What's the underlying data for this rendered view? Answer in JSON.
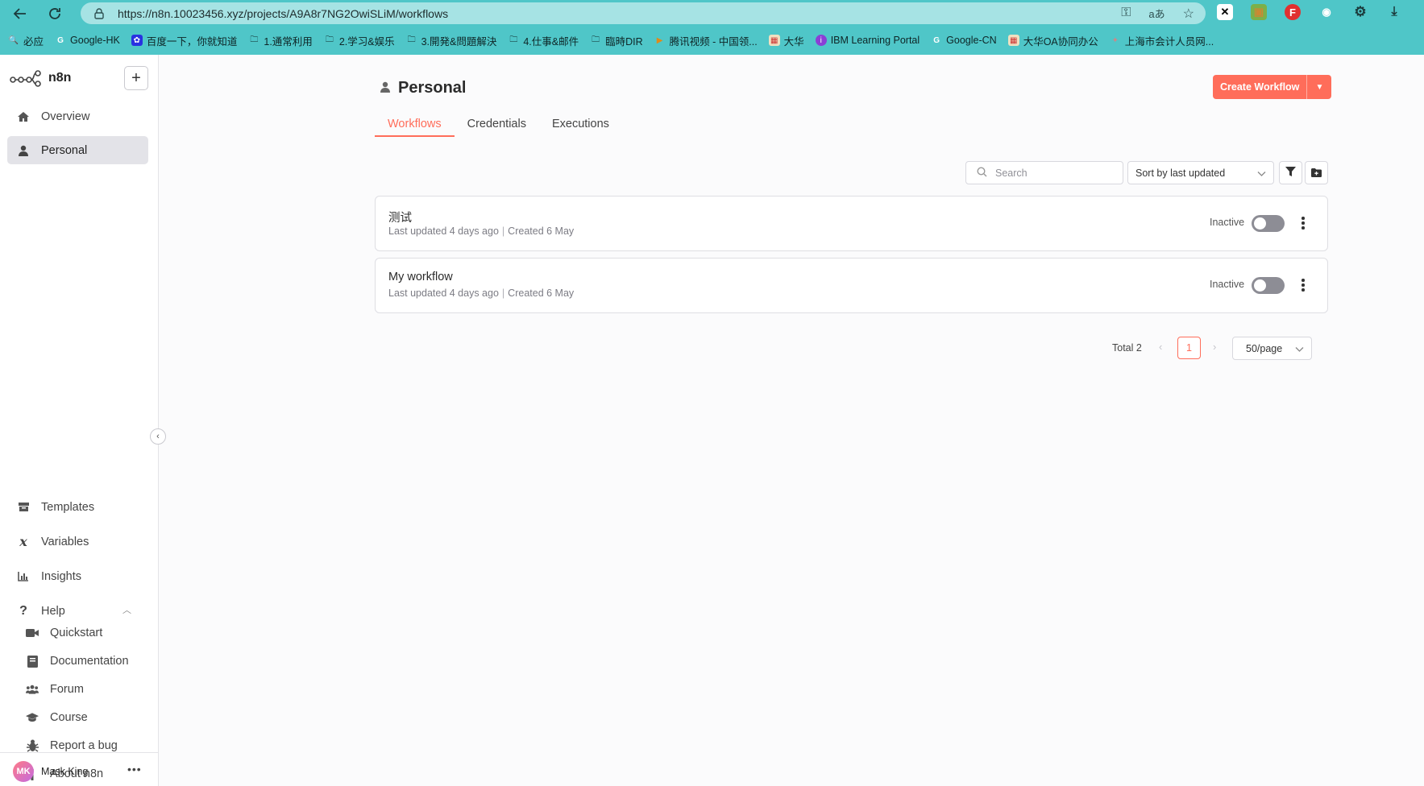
{
  "browser": {
    "url": "https://n8n.10023456.xyz/projects/A9A8r7NG2OwiSLiM/workflows",
    "bookmarks": [
      {
        "label": "必应",
        "icon": "bing-icon"
      },
      {
        "label": "Google-HK",
        "icon": "google-icon"
      },
      {
        "label": "百度一下，你就知道",
        "icon": "baidu-icon"
      },
      {
        "label": "1.通常利用",
        "icon": "folder-icon"
      },
      {
        "label": "2.学习&娱乐",
        "icon": "folder-icon"
      },
      {
        "label": "3.開発&問題解決",
        "icon": "folder-icon"
      },
      {
        "label": "4.仕事&邮件",
        "icon": "folder-icon"
      },
      {
        "label": "臨時DIR",
        "icon": "folder-icon"
      },
      {
        "label": "腾讯视频 - 中国领...",
        "icon": "tencent-video-icon"
      },
      {
        "label": "大华",
        "icon": "dahua-icon"
      },
      {
        "label": "IBM Learning Portal",
        "icon": "ibm-icon"
      },
      {
        "label": "Google-CN",
        "icon": "google-icon"
      },
      {
        "label": "大华OA协同办公",
        "icon": "dahua-icon"
      },
      {
        "label": "上海市会计人员网...",
        "icon": "shanghai-icon"
      }
    ]
  },
  "app": {
    "logo_text": "n8n",
    "sidebar": {
      "top_items": [
        {
          "label": "Overview",
          "icon": "home-icon"
        },
        {
          "label": "Personal",
          "icon": "user-icon",
          "active": true
        }
      ],
      "bottom_items": [
        {
          "label": "Templates",
          "icon": "box-icon"
        },
        {
          "label": "Variables",
          "icon": "variable-icon"
        },
        {
          "label": "Insights",
          "icon": "chart-icon"
        },
        {
          "label": "Help",
          "icon": "question-icon"
        }
      ],
      "help_items": [
        {
          "label": "Quickstart",
          "icon": "video-icon"
        },
        {
          "label": "Documentation",
          "icon": "book-icon"
        },
        {
          "label": "Forum",
          "icon": "users-icon"
        },
        {
          "label": "Course",
          "icon": "graduation-cap-icon"
        },
        {
          "label": "Report a bug",
          "icon": "bug-icon"
        },
        {
          "label": "About n8n",
          "icon": "info-icon"
        }
      ],
      "user": {
        "initials": "MK",
        "name": "Mask King"
      }
    },
    "page_title": "Personal",
    "create_button_label": "Create Workflow",
    "tabs": [
      "Workflows",
      "Credentials",
      "Executions"
    ],
    "active_tab": "Workflows",
    "search_placeholder": "Search",
    "sort_value": "Sort by last updated",
    "workflows": [
      {
        "name": "测试",
        "updated": "Last updated 4 days ago",
        "created": "Created 6 May",
        "status": "Inactive"
      },
      {
        "name": "My workflow",
        "updated": "Last updated 4 days ago",
        "created": "Created 6 May",
        "status": "Inactive"
      }
    ],
    "pagination": {
      "total_label": "Total 2",
      "current_page": "1",
      "per_page": "50/page"
    },
    "colors": {
      "accent": "#ff6d5a",
      "browser_bar": "#4fc6c8"
    }
  }
}
